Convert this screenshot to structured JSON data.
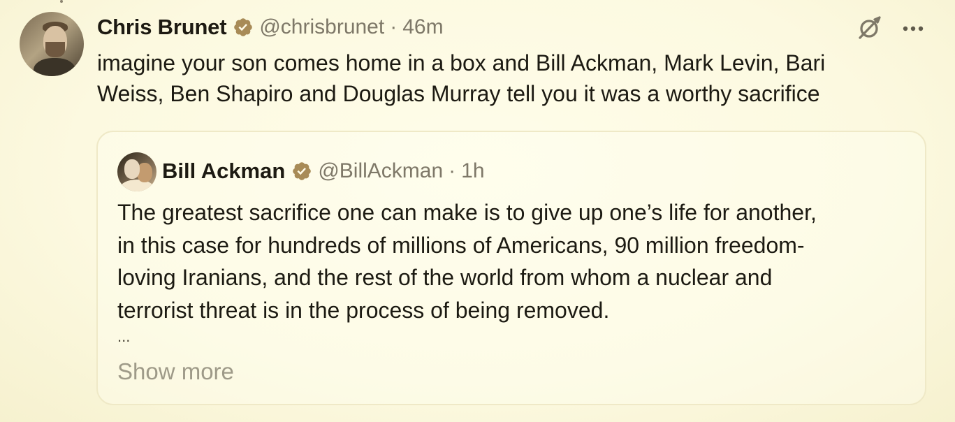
{
  "tweet": {
    "author_name": "Chris Brunet",
    "handle": "@chrisbrunet",
    "separator": "·",
    "time": "46m",
    "text": "imagine your son comes home in a box and Bill Ackman, Mark Levin, Bari\nWeiss, Ben Shapiro and Douglas Murray tell you it was a worthy sacrifice",
    "icons": {
      "verified": "verified-badge-icon",
      "grok": "grok-icon",
      "more": "more-options-icon"
    }
  },
  "quote": {
    "author_name": "Bill Ackman",
    "handle": "@BillAckman",
    "separator": "·",
    "time": "1h",
    "text": "The greatest sacrifice one can make is to give up one’s life for another,\nin this case for hundreds of millions of Americans, 90 million freedom-\nloving Iranians, and the rest of the world from whom a nuclear and\nterrorist threat is in the process of being removed.",
    "ellipsis": "...",
    "show_more_label": "Show more",
    "icons": {
      "verified": "verified-badge-icon"
    }
  },
  "colors": {
    "background": "#fdfbe6",
    "text": "#1c1a12",
    "secondary_text": "#7e7868",
    "verified_badge": "#a88b57",
    "show_more": "#9e9a88"
  }
}
